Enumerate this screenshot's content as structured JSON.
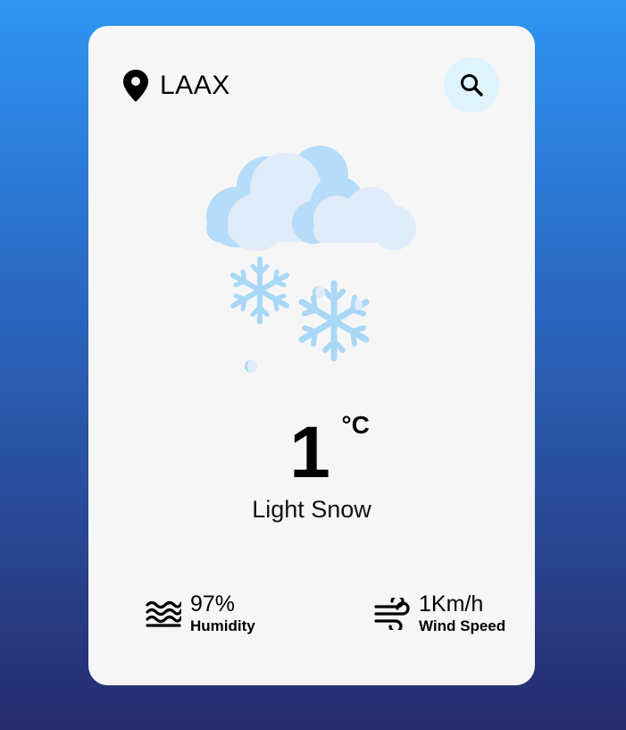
{
  "location": {
    "icon": "map-pin-icon",
    "city": "LAAX"
  },
  "search": {
    "icon": "search-icon"
  },
  "weather": {
    "icon": "light-snow-icon",
    "temperature": "1",
    "unit": "°C",
    "condition": "Light Snow"
  },
  "stats": {
    "humidity": {
      "icon": "humidity-waves-icon",
      "value": "97%",
      "label": "Humidity"
    },
    "wind": {
      "icon": "wind-icon",
      "value": "1Km/h",
      "label": "Wind Speed"
    }
  },
  "colors": {
    "background_top": "#2f96f2",
    "background_bottom": "#262b6d",
    "card": "#f6f6f6",
    "search_button": "#dff3fd",
    "cloud_light": "#e0ecf9",
    "cloud_dark": "#b5dcf8",
    "snow": "#a9d8f6"
  }
}
